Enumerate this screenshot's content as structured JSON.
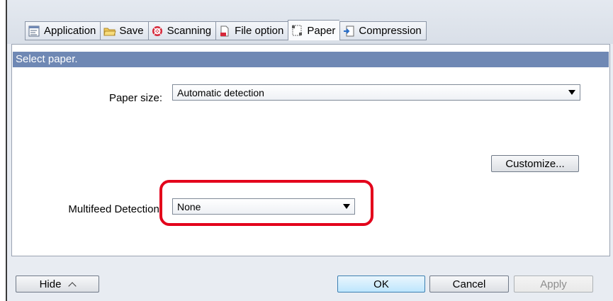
{
  "tabs": [
    {
      "label": "Application",
      "icon": "application-icon",
      "active": false
    },
    {
      "label": "Save",
      "icon": "folder-icon",
      "active": false
    },
    {
      "label": "Scanning",
      "icon": "scanning-icon",
      "active": false
    },
    {
      "label": "File option",
      "icon": "file-option-icon",
      "active": false
    },
    {
      "label": "Paper",
      "icon": "paper-icon",
      "active": true
    },
    {
      "label": "Compression",
      "icon": "compression-icon",
      "active": false
    }
  ],
  "section": {
    "header": "Select paper."
  },
  "paper_size": {
    "label": "Paper size:",
    "value": "Automatic detection"
  },
  "customize": {
    "label": "Customize..."
  },
  "multifeed": {
    "label": "Multifeed Detection:",
    "value": "None"
  },
  "footer": {
    "hide_label": "Hide",
    "ok_label": "OK",
    "cancel_label": "Cancel",
    "apply_label": "Apply"
  },
  "colors": {
    "section_header": "#6f88b4",
    "highlight": "#e3001b"
  }
}
